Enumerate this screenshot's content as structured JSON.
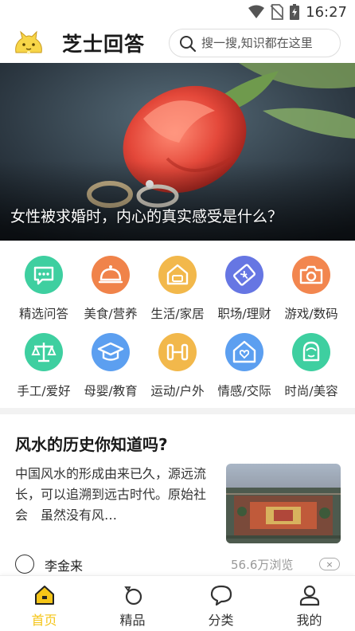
{
  "status_bar": {
    "time": "16:27"
  },
  "header": {
    "app_title": "芝士回答",
    "search_placeholder": "搜一搜,知识都在这里"
  },
  "banner": {
    "caption": "女性被求婚时，内心的真实感受是什么？"
  },
  "categories": [
    {
      "label": "精选问答",
      "icon": "chat-icon",
      "color": "#3ecfa0"
    },
    {
      "label": "美食/营养",
      "icon": "food-cloche-icon",
      "color": "#f0834a"
    },
    {
      "label": "生活/家居",
      "icon": "home-sofa-icon",
      "color": "#f2b84b"
    },
    {
      "label": "职场/理财",
      "icon": "ticket-yen-icon",
      "color": "#6676e3"
    },
    {
      "label": "游戏/数码",
      "icon": "camera-icon",
      "color": "#f2864f"
    },
    {
      "label": "手工/爱好",
      "icon": "scale-icon",
      "color": "#3ecfa0"
    },
    {
      "label": "母婴/教育",
      "icon": "graduation-cap-icon",
      "color": "#5c9ff0"
    },
    {
      "label": "运动/户外",
      "icon": "dumbbell-icon",
      "color": "#f2b84b"
    },
    {
      "label": "情感/交际",
      "icon": "heart-home-icon",
      "color": "#5c9ff0"
    },
    {
      "label": "时尚/美容",
      "icon": "face-icon",
      "color": "#3ecfa0"
    }
  ],
  "article": {
    "title": "风水的历史你知道吗?",
    "excerpt": " 中国风水的形成由来已久，源远流长，可以追溯到远古时代。原始社会　虽然没有风…",
    "author": "李金来",
    "views": "56.6万浏览",
    "dismiss": "×"
  },
  "tabs": [
    {
      "label": "首页",
      "icon": "home-icon",
      "active": true
    },
    {
      "label": "精品",
      "icon": "ring-icon",
      "active": false
    },
    {
      "label": "分类",
      "icon": "chat-bubble-icon",
      "active": false
    },
    {
      "label": "我的",
      "icon": "user-icon",
      "active": false
    }
  ],
  "colors": {
    "accent": "#f5c518",
    "divider": "#f2f2f2"
  }
}
